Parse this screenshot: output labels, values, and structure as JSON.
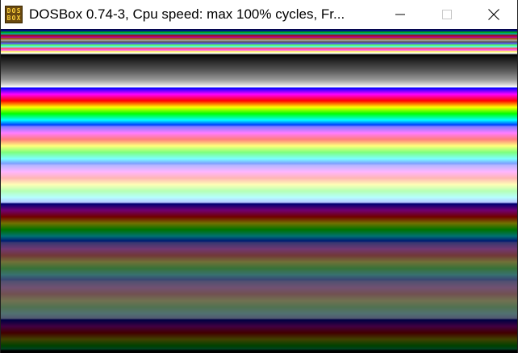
{
  "window": {
    "title": "DOSBox 0.74-3, Cpu speed: max 100% cycles, Fr...",
    "icon_text": [
      "D",
      "O",
      "S",
      "B",
      "O",
      "X"
    ]
  },
  "controls": {
    "minimize": "minimize-icon",
    "maximize": "maximize-icon",
    "close": "close-icon"
  },
  "colors": {
    "titlebar_bg": "#ffffff",
    "icon_bg": "#6a4a10",
    "icon_text": "#ffd23a"
  }
}
